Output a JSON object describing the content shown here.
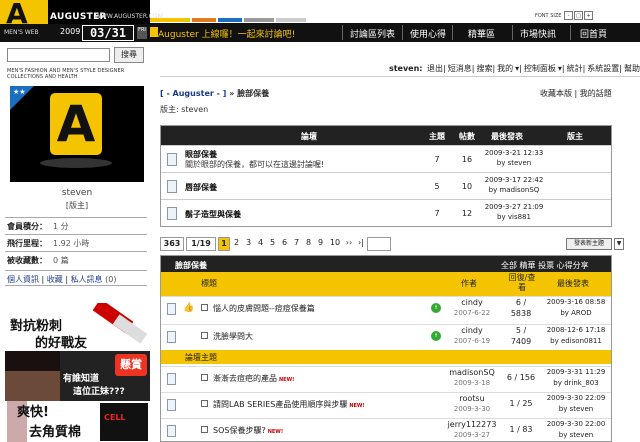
{
  "logo": {
    "letter": "A",
    "name": "AUGUSTER",
    "url": "WWW.AUGUSTER.COM",
    "section": "MEN'S WEB",
    "year": "2009",
    "date": "03/31",
    "day": "FRI",
    "brand_color": "#f5c400"
  },
  "font_size": {
    "label": "FONT SIZE",
    "small": "-",
    "large": "+"
  },
  "nav": {
    "welcome": "Auguster 上線囉！一起來討論吧!",
    "items": [
      "討論區列表",
      "使用心得",
      "精華區",
      "市場快訊",
      "回首頁"
    ]
  },
  "search": {
    "placeholder": "",
    "button": "搜尋"
  },
  "tagline": "MEN'S FASHION AND MEN'S STYLE DESIGNER COLLECTIONS AND HEALTH",
  "userbar": {
    "user": "steven:",
    "links": [
      "退出",
      "短消息",
      "搜索",
      "我的",
      "控制面板",
      "統計",
      "系統設置",
      "幫助"
    ]
  },
  "breadcrumb": {
    "root": "[ - Auguster - ]",
    "sep": "»",
    "current": "臉部保養"
  },
  "moderator": {
    "label": "版主:",
    "name": "steven"
  },
  "rightlinks": {
    "a": "收藏本版",
    "b": "我的話題"
  },
  "profile": {
    "name": "steven",
    "role": "[版主]",
    "stats": [
      {
        "k": "會員積分：",
        "v": "1 分"
      },
      {
        "k": "飛行里程：",
        "v": "1.92 小時"
      },
      {
        "k": "被收藏數：",
        "v": "0 篇"
      }
    ],
    "links": [
      "個人資訊",
      "收藏",
      "私人訊息",
      "(0)"
    ]
  },
  "ads": {
    "ad1": {
      "line1": "對抗粉刺",
      "line2": "的好戰友"
    },
    "ad2": {
      "line1": "有誰知道",
      "line2": "這位正妹???",
      "badge": "懸賞"
    },
    "ad3": {
      "line1": "爽快!",
      "line2": "去角質棉",
      "pkg": "CELL"
    }
  },
  "subforums": {
    "headers": {
      "name": "論壇",
      "topics": "主題",
      "posts": "帖數",
      "last": "最後發表",
      "mod": "版主"
    },
    "rows": [
      {
        "name": "眼部保養",
        "desc": "關於眼部的保養，都可以在這邊討論喔!",
        "topics": "7",
        "posts": "16",
        "last_time": "2009-3-21 12:33",
        "last_by": "by steven"
      },
      {
        "name": "唇部保養",
        "desc": "",
        "topics": "5",
        "posts": "10",
        "last_time": "2009-3-17 22:42",
        "last_by": "by madisonSQ"
      },
      {
        "name": "鬍子造型與保養",
        "desc": "",
        "topics": "7",
        "posts": "12",
        "last_time": "2009-3-27 21:09",
        "last_by": "by vis881"
      }
    ]
  },
  "pager": {
    "total": "363",
    "pages": "1/19",
    "current": "1",
    "nums": [
      "2",
      "3",
      "4",
      "5",
      "6",
      "7",
      "8",
      "9",
      "10"
    ],
    "next": "››",
    "last": "›|",
    "new_btn": "發表新主題",
    "arrow": "▼"
  },
  "topics": {
    "section": "臉部保養",
    "tabs": "全部 精華 投票 心得分享",
    "headers": {
      "title": "標題",
      "author": "作者",
      "replies": "回復/查看",
      "last": "最後發表"
    },
    "sub_section": "論壇主題",
    "new_tag": "NEW!",
    "pinned": [
      {
        "title": "惱人的皮膚問題--痘痘保養篇",
        "author": "cindy",
        "date": "2007-6-22",
        "replies": "6 /",
        "views": "5838",
        "last_time": "2009-3-16 08:58",
        "last_by": "by AROD",
        "pinned": true
      },
      {
        "title": "洗臉學問大",
        "author": "cindy",
        "date": "2007-6-19",
        "replies": "5 /",
        "views": "7409",
        "last_time": "2008-12-6 17:18",
        "last_by": "by edison0811",
        "pinned": false
      }
    ],
    "rows": [
      {
        "title": "漸漸去痘疤的產品",
        "author": "madisonSQ",
        "date": "2009-3-18",
        "replies": "6 / 156",
        "last_time": "2009-3-31 11:29",
        "last_by": "by drink_803"
      },
      {
        "title": "請問LAB SERIES產品使用順序與步驟",
        "author": "rootsu",
        "date": "2009-3-30",
        "replies": "1 / 25",
        "last_time": "2009-3-30 22:09",
        "last_by": "by steven"
      },
      {
        "title": "SOS保養步驟?",
        "author": "jerry112273",
        "date": "2009-3-27",
        "replies": "1 / 83",
        "last_time": "2009-3-30 22:00",
        "last_by": "by steven"
      }
    ]
  }
}
